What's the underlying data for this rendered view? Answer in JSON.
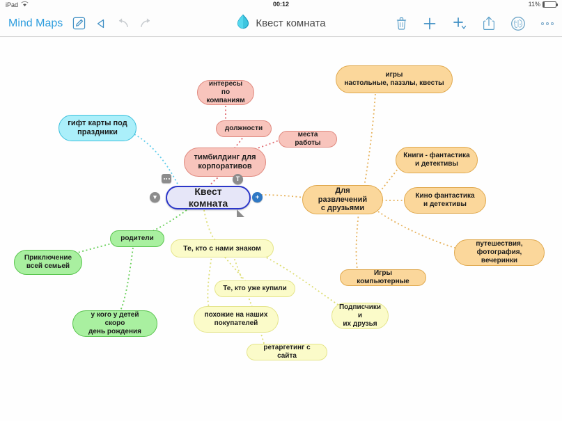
{
  "status_bar": {
    "device": "iPad",
    "wifi_icon": "wifi-icon",
    "time": "00:12",
    "battery_percent": "11%"
  },
  "toolbar": {
    "back_label": "Mind Maps",
    "title": "Квест комната",
    "doc_icon": "droplet-icon",
    "left_icons": [
      {
        "name": "edit-compose-icon",
        "glyph": "compose"
      },
      {
        "name": "play-back-icon",
        "glyph": "triangle-left"
      },
      {
        "name": "undo-icon",
        "glyph": "undo-arrow"
      },
      {
        "name": "redo-icon",
        "glyph": "redo-arrow"
      }
    ],
    "right_icons": [
      {
        "name": "trash-icon",
        "glyph": "trash"
      },
      {
        "name": "add-icon",
        "glyph": "plus"
      },
      {
        "name": "add-child-icon",
        "glyph": "plus-chevron"
      },
      {
        "name": "share-icon",
        "glyph": "share-up"
      },
      {
        "name": "brain-icon",
        "glyph": "brain"
      },
      {
        "name": "more-icon",
        "glyph": "three-dots"
      }
    ]
  },
  "mindmap": {
    "root": {
      "label": "Квест комната",
      "color": "#e6e6f8",
      "border": "#2b36c9"
    },
    "branches": [
      {
        "name": "gift-cards",
        "color": "#abeffa",
        "nodes": [
          {
            "label": "гифт карты под\nпраздники"
          }
        ]
      },
      {
        "name": "teambuilding",
        "color": "#f8c4bc",
        "nodes": [
          {
            "label": "тимбилдинг для\nкорпоративов"
          },
          {
            "label": "интересы по\nкомпаниям"
          },
          {
            "label": "должности"
          },
          {
            "label": "места работы"
          }
        ]
      },
      {
        "name": "entertainment",
        "color": "#fbd79b",
        "nodes": [
          {
            "label": "Для развлечений\nс друзьями"
          },
          {
            "label": "игры\nнастольные, паззлы, квесты"
          },
          {
            "label": "Книги - фантастика\nи детективы"
          },
          {
            "label": "Кино фантастика\nи детективы"
          },
          {
            "label": "путешествия,\nфотография, вечеринки"
          },
          {
            "label": "Игры компьютерные"
          }
        ]
      },
      {
        "name": "parents",
        "color": "#a9f0a0",
        "nodes": [
          {
            "label": "родители"
          },
          {
            "label": "Приключение\nвсей семьей"
          },
          {
            "label": "у кого у детей скоро\nдень рождения"
          }
        ]
      },
      {
        "name": "acquaintances",
        "color": "#fbfbc9",
        "nodes": [
          {
            "label": "Те, кто с нами знаком"
          },
          {
            "label": "Те, кто уже купили"
          },
          {
            "label": "похожие на наших\nпокупателей"
          },
          {
            "label": "ретаргетинг с сайта"
          },
          {
            "label": "Подписчики и\nих друзья"
          }
        ]
      }
    ],
    "handles": [
      {
        "name": "collapse-handle",
        "glyph": "▼"
      },
      {
        "name": "add-sibling-handle",
        "glyph": "+"
      },
      {
        "name": "note-handle",
        "glyph": "dots"
      },
      {
        "name": "text-style-handle",
        "glyph": "T"
      },
      {
        "name": "resize-handle",
        "glyph": "corner"
      }
    ]
  }
}
